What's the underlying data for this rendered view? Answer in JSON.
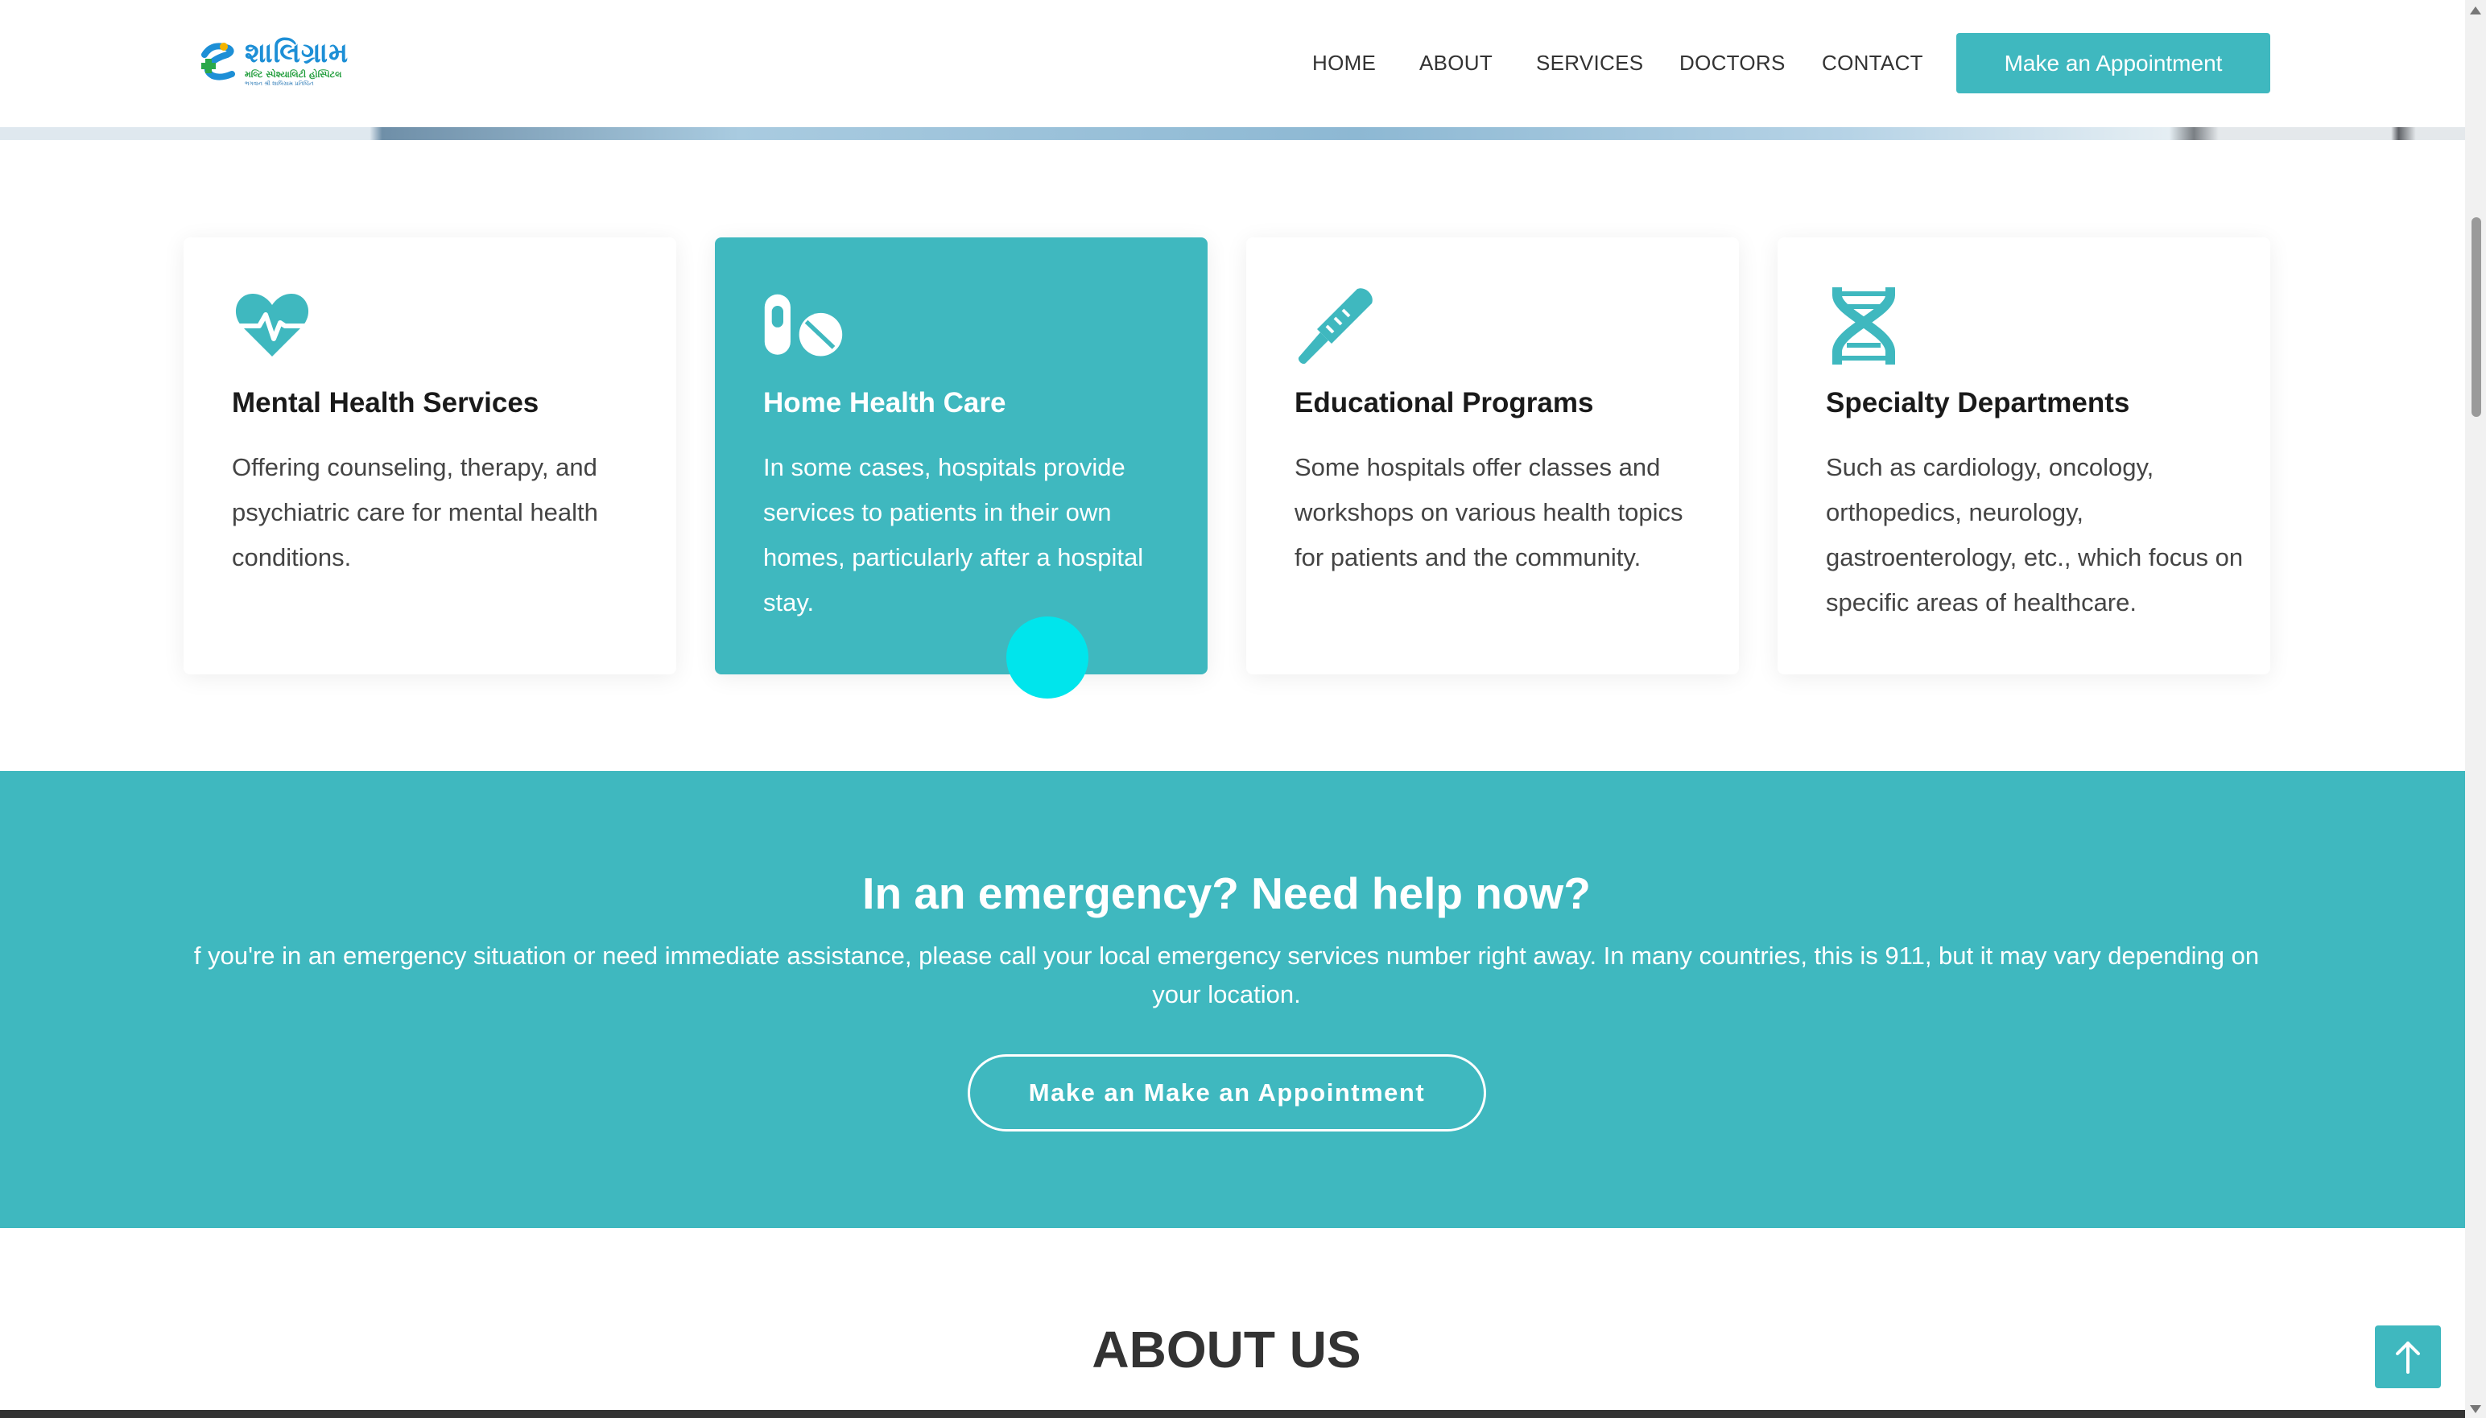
{
  "header": {
    "logo_text": "શાલિગ્રામ",
    "logo_subtext": "મલ્ટિ સ્પેશ્યાલિટી હોસ્પિટલ",
    "logo_tagline": "ભગવાન શ્રી શાલિગ્રામ પ્રતિષ્ઠિત",
    "nav": [
      "HOME",
      "ABOUT",
      "SERVICES",
      "DOCTORS",
      "CONTACT"
    ],
    "appointment_button": "Make an Appointment"
  },
  "cards": [
    {
      "icon": "heart-pulse-icon",
      "title": "Mental Health Services",
      "description": "Offering counseling, therapy, and psychiatric care for mental health conditions.",
      "active": false
    },
    {
      "icon": "pills-icon",
      "title": "Home Health Care",
      "description": "In some cases, hospitals provide services to patients in their own homes, particularly after a hospital stay.",
      "active": true
    },
    {
      "icon": "thermometer-icon",
      "title": "Educational Programs",
      "description": "Some hospitals offer classes and workshops on various health topics for patients and the community.",
      "active": false
    },
    {
      "icon": "dna-icon",
      "title": "Specialty Departments",
      "description": "Such as cardiology, oncology, orthopedics, neurology, gastroenterology, etc., which focus on specific areas of healthcare.",
      "active": false
    }
  ],
  "emergency": {
    "title": "In an emergency? Need help now?",
    "text": "f you're in an emergency situation or need immediate assistance, please call your local emergency services number right away. In many countries, this is 911, but it may vary depending on your location.",
    "button": "Make an Make an Appointment"
  },
  "about": {
    "title": "ABOUT US"
  },
  "colors": {
    "accent": "#3fb8bf",
    "cursor": "#00e5ec"
  }
}
